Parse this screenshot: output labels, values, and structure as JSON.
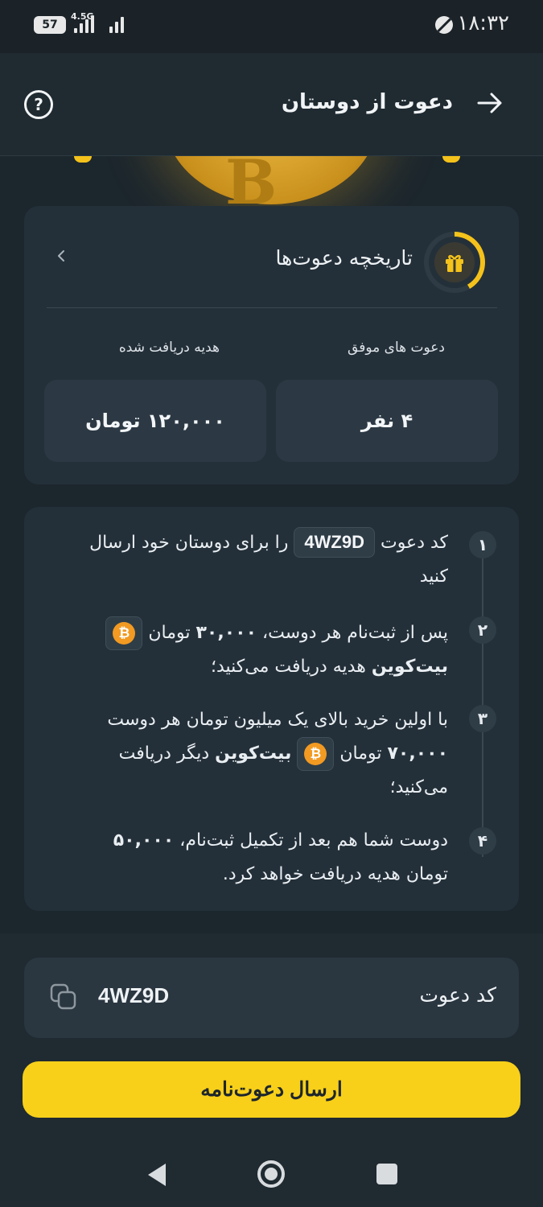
{
  "status_bar": {
    "battery": "57",
    "network": "4.5G",
    "time": "۱۸:۳۲"
  },
  "header": {
    "title": "دعوت از دوستان",
    "help_icon_label": "?"
  },
  "hero": {
    "coin_symbol": "B"
  },
  "history": {
    "title": "تاریخچه دعوت‌ها",
    "successful_label": "دعوت های موفق",
    "successful_value": "۴ نفر",
    "reward_label": "هدیه دریافت شده",
    "reward_value": "۱۲۰,۰۰۰ تومان"
  },
  "steps": [
    {
      "num": "۱",
      "part1": "کد دعوت",
      "code": "4WZ9D",
      "part2": "را برای دوستان خود ارسال کنید"
    },
    {
      "num": "۲",
      "part1": "پس از ثبت‌نام هر دوست،",
      "amount": "۳۰,۰۰۰",
      "part2": "تومان",
      "btc_label": "بیت‌کوین",
      "part3": "هدیه دریافت می‌کنید؛"
    },
    {
      "num": "۳",
      "part1": "با اولین خرید بالای یک میلیون تومان هر دوست",
      "amount": "۷۰,۰۰۰",
      "part2": "تومان",
      "btc_label": "بیت‌کوین",
      "part3": "دیگر دریافت می‌کنید؛"
    },
    {
      "num": "۴",
      "part1": "دوست شما هم بعد از تکمیل ثبت‌نام،",
      "amount": "۵۰,۰۰۰",
      "part2": "تومان هدیه دریافت خواهد کرد."
    }
  ],
  "btc_symbol": "₿",
  "invite_code": {
    "label": "کد دعوت",
    "value": "4WZ9D"
  },
  "send_button": {
    "label": "ارسال دعوت‌نامه"
  },
  "colors": {
    "accent": "#f8d01a",
    "background": "#1c262d",
    "card": "#243039",
    "bitcoin": "#f29a22"
  }
}
